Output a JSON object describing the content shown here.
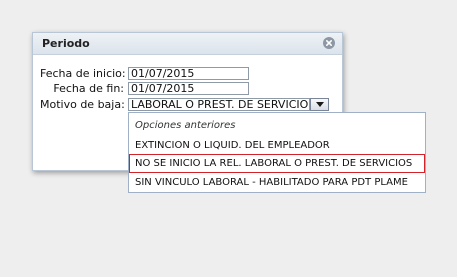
{
  "dialog": {
    "title": "Periodo",
    "close_icon": "close-circle-icon"
  },
  "form": {
    "start_label": "Fecha de inicio:",
    "start_value": "01/07/2015",
    "end_label": "Fecha de fin:",
    "end_value": "01/07/2015",
    "reason_label": "Motivo de baja:",
    "reason_value": "LABORAL O PREST. DE SERVICIOS",
    "reason_arrow_icon": "chevron-down-icon"
  },
  "dropdown": {
    "options": [
      {
        "label": "Opciones anteriores",
        "kind": "group-header"
      },
      {
        "label": "EXTINCION O LIQUID. DEL EMPLEADOR",
        "kind": "option"
      },
      {
        "label": "NO SE INICIO LA REL. LABORAL O PREST. DE SERVICIOS",
        "kind": "option",
        "highlighted": true
      },
      {
        "label": "SIN VINCULO LABORAL - HABILITADO PARA PDT PLAME",
        "kind": "option"
      }
    ]
  },
  "colors": {
    "highlight_border": "#d2232a",
    "dialog_border": "#b9c6d6",
    "titlebar": "#dbe3ec"
  }
}
